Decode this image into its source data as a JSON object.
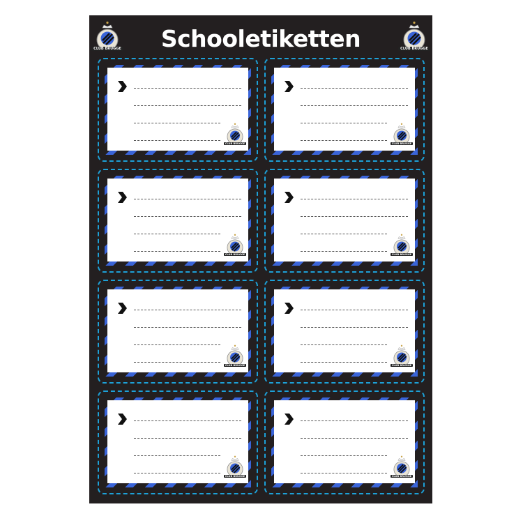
{
  "header": {
    "title": "Schooletiketten"
  },
  "logo": {
    "text": "CLUB BRUGGE",
    "colors": {
      "blue": "#3a64d8",
      "black": "#111",
      "gold": "#c9a44a"
    }
  },
  "labels": [
    {
      "lines": 4
    },
    {
      "lines": 4
    },
    {
      "lines": 4
    },
    {
      "lines": 4
    },
    {
      "lines": 4
    },
    {
      "lines": 4
    },
    {
      "lines": 4
    },
    {
      "lines": 4
    }
  ],
  "colors": {
    "background": "#231f20",
    "stripe": "#3a64d8",
    "cut_line": "#1da1d8"
  }
}
